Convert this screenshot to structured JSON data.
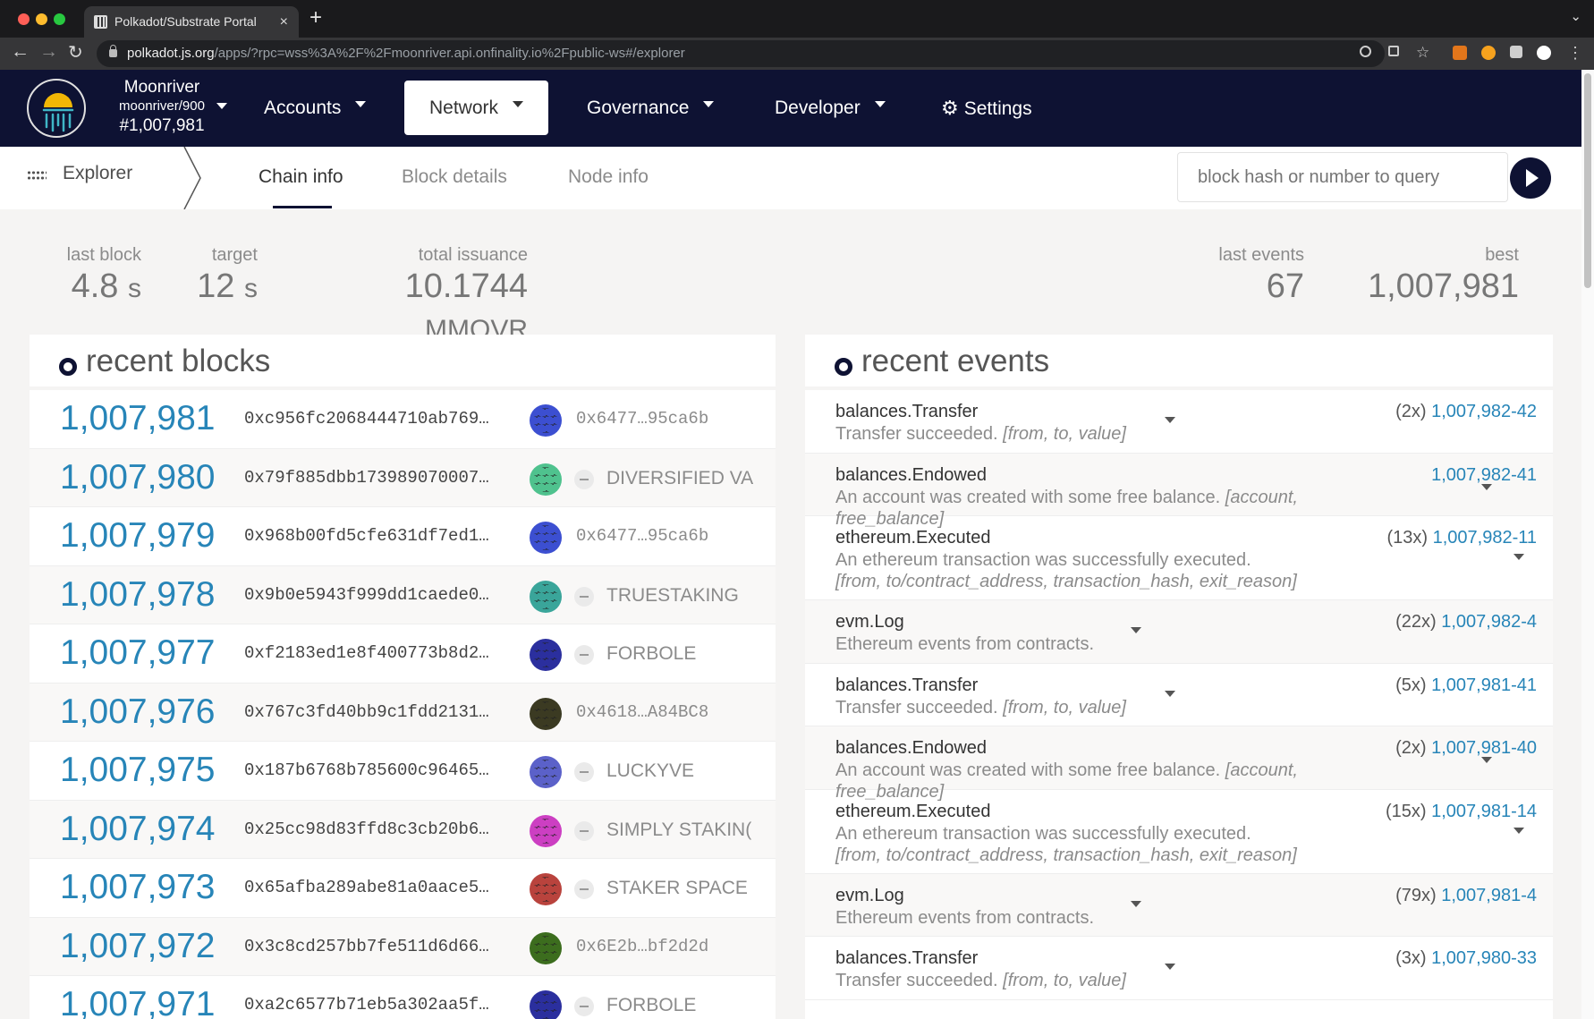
{
  "browser": {
    "tab_title": "Polkadot/Substrate Portal",
    "url_host": "polkadot.js.org",
    "url_path": "/apps/?rpc=wss%3A%2F%2Fmoonriver.api.onfinality.io%2Fpublic-ws#/explorer",
    "new_tab_label": "+",
    "close_tab_label": "×"
  },
  "header": {
    "chain_name": "Moonriver",
    "chain_version": "moonriver/900",
    "chain_block": "#1,007,981",
    "menu": [
      {
        "label": "Accounts"
      },
      {
        "label": "Network"
      },
      {
        "label": "Governance"
      },
      {
        "label": "Developer"
      },
      {
        "label": "Settings"
      }
    ],
    "active_menu": "Network"
  },
  "subnav": {
    "section": "Explorer",
    "tabs": [
      {
        "label": "Chain info"
      },
      {
        "label": "Block details"
      },
      {
        "label": "Node info"
      }
    ],
    "active_tab": "Chain info",
    "query_placeholder": "block hash or number to query"
  },
  "summary": {
    "last_block_label": "last block",
    "last_block_value": "4.8",
    "last_block_unit": "s",
    "target_label": "target",
    "target_value": "12",
    "target_unit": "s",
    "issuance_label": "total issuance",
    "issuance_value": "10.1744",
    "issuance_unit": "MMOVR",
    "last_events_label": "last events",
    "last_events_value": "67",
    "best_label": "best",
    "best_value": "1,007,981"
  },
  "recent_blocks": {
    "title": "recent blocks",
    "rows": [
      {
        "number": "1,007,981",
        "hash": "0xc956fc2068444710ab769…",
        "author": "0x6477…95ca6b",
        "author_is_address": true,
        "avatar_color": "#3c4fd1"
      },
      {
        "number": "1,007,980",
        "hash": "0x79f885dbb173989070007…",
        "author": "DIVERSIFIED VA",
        "author_is_address": false,
        "avatar_color": "#4fc28e"
      },
      {
        "number": "1,007,979",
        "hash": "0x968b00fd5cfe631df7ed1…",
        "author": "0x6477…95ca6b",
        "author_is_address": true,
        "avatar_color": "#3c4fd1"
      },
      {
        "number": "1,007,978",
        "hash": "0x9b0e5943f999dd1caede0…",
        "author": "TRUESTAKING",
        "author_is_address": false,
        "avatar_color": "#3aa59a"
      },
      {
        "number": "1,007,977",
        "hash": "0xf2183ed1e8f400773b8d2…",
        "author": "FORBOLE",
        "author_is_address": false,
        "avatar_color": "#2b2f9e"
      },
      {
        "number": "1,007,976",
        "hash": "0x767c3fd40bb9c1fdd2131…",
        "author": "0x4618…A84BC8",
        "author_is_address": true,
        "avatar_color": "#3b3a22"
      },
      {
        "number": "1,007,975",
        "hash": "0x187b6768b785600c96465…",
        "author": "LUCKYVE",
        "author_is_address": false,
        "avatar_color": "#5b61c9"
      },
      {
        "number": "1,007,974",
        "hash": "0x25cc98d83ffd8c3cb20b6…",
        "author": "SIMPLY STAKIN(",
        "author_is_address": false,
        "avatar_color": "#cc3fc2"
      },
      {
        "number": "1,007,973",
        "hash": "0x65afba289abe81a0aace5…",
        "author": "STAKER SPACE",
        "author_is_address": false,
        "avatar_color": "#b9433d"
      },
      {
        "number": "1,007,972",
        "hash": "0x3c8cd257bb7fe511d6d66…",
        "author": "0x6E2b…bf2d2d",
        "author_is_address": true,
        "avatar_color": "#3c6d1e"
      },
      {
        "number": "1,007,971",
        "hash": "0xa2c6577b71eb5a302aa5f…",
        "author": "FORBOLE",
        "author_is_address": false,
        "avatar_color": "#2b2f9e"
      }
    ]
  },
  "recent_events": {
    "title": "recent events",
    "rows": [
      {
        "name": "balances.Transfer",
        "desc": "Transfer succeeded.",
        "params": "[from, to, value]",
        "count": "(2x)",
        "ref": "1,007,982-42"
      },
      {
        "name": "balances.Endowed",
        "desc": "An account was created with some free balance.",
        "params": "[account, free_balance]",
        "count": "",
        "ref": "1,007,982-41"
      },
      {
        "name": "ethereum.Executed",
        "desc": "An ethereum transaction was successfully executed.",
        "params": "[from, to/contract_address, transaction_hash, exit_reason]",
        "count": "(13x)",
        "ref": "1,007,982-11"
      },
      {
        "name": "evm.Log",
        "desc": "Ethereum events from contracts.",
        "params": "",
        "count": "(22x)",
        "ref": "1,007,982-4"
      },
      {
        "name": "balances.Transfer",
        "desc": "Transfer succeeded.",
        "params": "[from, to, value]",
        "count": "(5x)",
        "ref": "1,007,981-41"
      },
      {
        "name": "balances.Endowed",
        "desc": "An account was created with some free balance.",
        "params": "[account, free_balance]",
        "count": "(2x)",
        "ref": "1,007,981-40"
      },
      {
        "name": "ethereum.Executed",
        "desc": "An ethereum transaction was successfully executed.",
        "params": "[from, to/contract_address, transaction_hash, exit_reason]",
        "count": "(15x)",
        "ref": "1,007,981-14"
      },
      {
        "name": "evm.Log",
        "desc": "Ethereum events from contracts.",
        "params": "",
        "count": "(79x)",
        "ref": "1,007,981-4"
      },
      {
        "name": "balances.Transfer",
        "desc": "Transfer succeeded.",
        "params": "[from, to, value]",
        "count": "(3x)",
        "ref": "1,007,980-33"
      }
    ]
  },
  "colors": {
    "header_bg": "#0e1233",
    "link": "#2785b8",
    "page_bg": "#f5f4f3"
  }
}
